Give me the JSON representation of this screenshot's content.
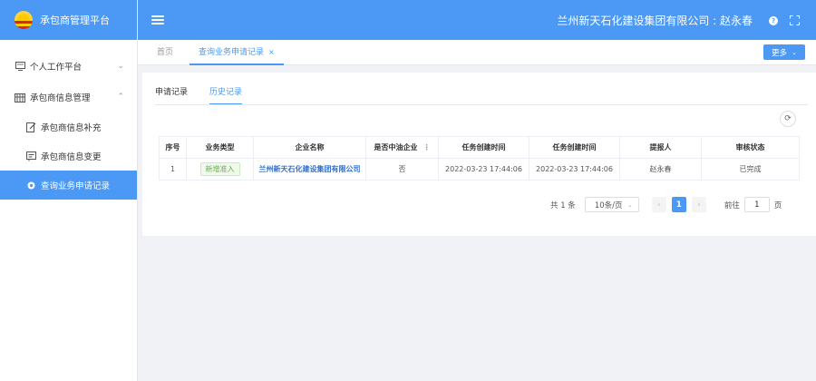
{
  "app": {
    "title": "承包商管理平台"
  },
  "header": {
    "user_text": "兰州新天石化建设集团有限公司 : 赵永春"
  },
  "sidebar": {
    "items": [
      {
        "label": "个人工作平台"
      },
      {
        "label": "承包商信息管理"
      },
      {
        "label": "承包商信息补充"
      },
      {
        "label": "承包商信息变更"
      },
      {
        "label": "查询业务申请记录"
      }
    ]
  },
  "tabs": {
    "home": "首页",
    "current": "查询业务申请记录",
    "close": "×",
    "more": "更多"
  },
  "subtabs": {
    "apply": "申请记录",
    "history": "历史记录"
  },
  "table": {
    "headers": [
      "序号",
      "业务类型",
      "企业名称",
      "是否中油企业",
      "任务创建时间",
      "任务创建时间",
      "提报人",
      "审核状态"
    ],
    "rows": [
      {
        "index": "1",
        "type": "新增准入",
        "company": "兰州新天石化建设集团有限公司",
        "is_cnpc": "否",
        "created1": "2022-03-23 17:44:06",
        "created2": "2022-03-23 17:44:06",
        "submitter": "赵永春",
        "status": "已完成"
      }
    ]
  },
  "pager": {
    "total": "共 1 条",
    "page_size": "10条/页",
    "current_page": "1",
    "goto_label": "前往",
    "goto_value": "1",
    "page_unit": "页"
  },
  "colors": {
    "primary": "#4b98f5",
    "success": "#5fb346"
  }
}
